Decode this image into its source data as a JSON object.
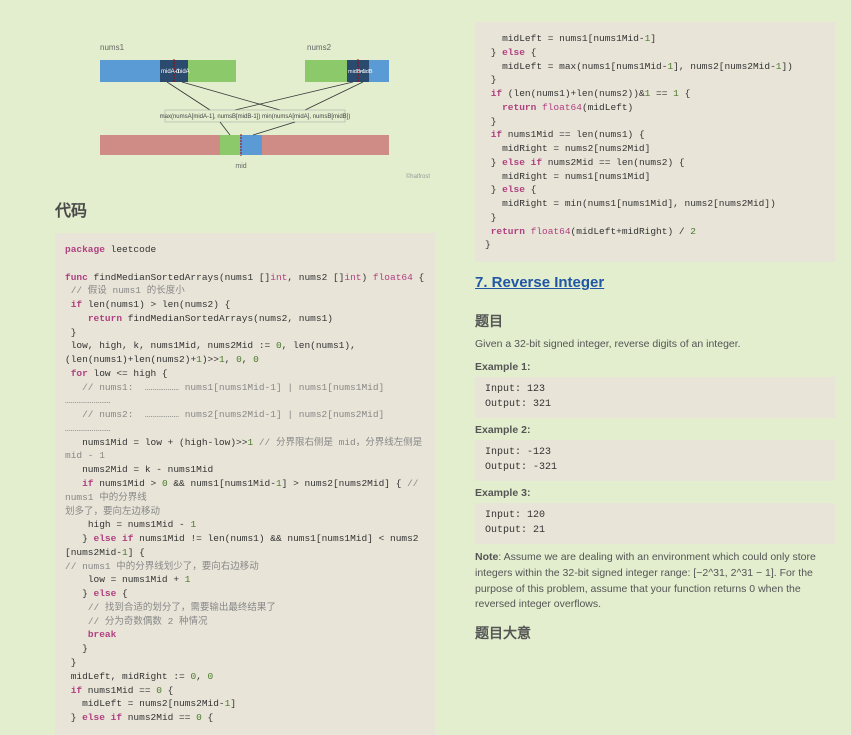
{
  "diagram": {
    "label_nums1": "nums1",
    "label_nums2": "nums2",
    "mid_label_a": "midA-1",
    "mid_label_a2": "midA",
    "mid_label_b": "midB-1",
    "mid_label_b2": "midB",
    "formula": "max(numsA[midA-1], numsB[midB-1])    min(numsA[midA], numsB[midB])",
    "mid_bottom": "mid",
    "watermark": "©halfrost"
  },
  "left": {
    "heading": "代码",
    "code_lines": [
      {
        "t": "<span class='kw'>package</span> leetcode"
      },
      {
        "t": ""
      },
      {
        "t": "<span class='kw'>func</span> <span class='fn'>findMedianSortedArrays</span>(nums1 []<span class='ty'>int</span>, nums2 []<span class='ty'>int</span>) <span class='ty'>float64</span> {"
      },
      {
        "t": " <span class='cm'>// 假设 nums1 的长度小</span>"
      },
      {
        "t": " <span class='kw'>if</span> <span class='fn'>len</span>(nums1) > <span class='fn'>len</span>(nums2) {"
      },
      {
        "t": "    <span class='kw'>return</span> findMedianSortedArrays(nums2, nums1)"
      },
      {
        "t": " }"
      },
      {
        "t": " low, high, k, nums1Mid, nums2Mid := <span class='nm'>0</span>, <span class='fn'>len</span>(nums1), "
      },
      {
        "t": "(<span class='fn'>len</span>(nums1)+<span class='fn'>len</span>(nums2)+<span class='nm'>1</span>)>><span class='nm'>1</span>, <span class='nm'>0</span>, <span class='nm'>0</span>"
      },
      {
        "t": " <span class='kw'>for</span> low <= high {"
      },
      {
        "t": "   <span class='cm'>// nums1:  ……………… nums1[nums1Mid-1] | nums1[nums1Mid] ……………………</span>"
      },
      {
        "t": "   <span class='cm'>// nums2:  ……………… nums2[nums2Mid-1] | nums2[nums2Mid] ……………………</span>"
      },
      {
        "t": "   nums1Mid = low + (high-low)>><span class='nm'>1</span> <span class='cm'>// 分界限右侧是 mid，分界线左侧是 mid - 1</span>"
      },
      {
        "t": "   nums2Mid = k - nums1Mid"
      },
      {
        "t": "   <span class='kw'>if</span> nums1Mid > <span class='nm'>0</span> && nums1[nums1Mid-<span class='nm'>1</span>] > nums2[nums2Mid] { <span class='cm'>// nums1 中的分界线</span>"
      },
      {
        "t": "<span class='cm'>划多了，要向左边移动</span>"
      },
      {
        "t": "    high = nums1Mid - <span class='nm'>1</span>"
      },
      {
        "t": "   } <span class='kw'>else if</span> nums1Mid != <span class='fn'>len</span>(nums1) && nums1[nums1Mid] < nums2[nums2Mid-<span class='nm'>1</span>] { "
      },
      {
        "t": "<span class='cm'>// nums1 中的分界线划少了，要向右边移动</span>"
      },
      {
        "t": "    low = nums1Mid + <span class='nm'>1</span>"
      },
      {
        "t": "   } <span class='kw'>else</span> {"
      },
      {
        "t": "    <span class='cm'>// 找到合适的划分了，需要输出最终结果了</span>"
      },
      {
        "t": "    <span class='cm'>// 分为奇数偶数 2 种情况</span>"
      },
      {
        "t": "    <span class='kw'>break</span>"
      },
      {
        "t": "   }"
      },
      {
        "t": " }"
      },
      {
        "t": " midLeft, midRight := <span class='nm'>0</span>, <span class='nm'>0</span>"
      },
      {
        "t": " <span class='kw'>if</span> nums1Mid == <span class='nm'>0</span> {"
      },
      {
        "t": "   midLeft = nums2[nums2Mid-<span class='nm'>1</span>]"
      },
      {
        "t": " } <span class='kw'>else if</span> nums2Mid == <span class='nm'>0</span> {"
      }
    ]
  },
  "right": {
    "code_lines": [
      {
        "t": "   midLeft = nums1[nums1Mid-<span class='nm'>1</span>]"
      },
      {
        "t": " } <span class='kw'>else</span> {"
      },
      {
        "t": "   midLeft = <span class='fn'>max</span>(nums1[nums1Mid-<span class='nm'>1</span>], nums2[nums2Mid-<span class='nm'>1</span>])"
      },
      {
        "t": " }"
      },
      {
        "t": " <span class='kw'>if</span> (<span class='fn'>len</span>(nums1)+<span class='fn'>len</span>(nums2))&<span class='nm'>1</span> == <span class='nm'>1</span> {"
      },
      {
        "t": "   <span class='kw'>return</span> <span class='ty'>float64</span>(midLeft)"
      },
      {
        "t": " }"
      },
      {
        "t": " <span class='kw'>if</span> nums1Mid == <span class='fn'>len</span>(nums1) {"
      },
      {
        "t": "   midRight = nums2[nums2Mid]"
      },
      {
        "t": " } <span class='kw'>else if</span> nums2Mid == <span class='fn'>len</span>(nums2) {"
      },
      {
        "t": "   midRight = nums1[nums1Mid]"
      },
      {
        "t": " } <span class='kw'>else</span> {"
      },
      {
        "t": "   midRight = <span class='fn'>min</span>(nums1[nums1Mid], nums2[nums2Mid])"
      },
      {
        "t": " }"
      },
      {
        "t": " <span class='kw'>return</span> <span class='ty'>float64</span>(midLeft+midRight) / <span class='nm'>2</span>"
      },
      {
        "t": "}"
      }
    ],
    "link_heading": "7. Reverse Integer",
    "sub_heading_1": "题目",
    "desc": "Given a 32-bit signed integer, reverse digits of an integer.",
    "example1_label": "Example 1:",
    "example1_io": "Input: 123\nOutput: 321",
    "example2_label": "Example 2:",
    "example2_io": "Input: -123\nOutput: -321",
    "example3_label": "Example 3:",
    "example3_io": "Input: 120\nOutput: 21",
    "note_label": "Note",
    "note_text": ": Assume we are dealing with an environment which could only store integers within the 32-bit signed integer range: [−2^31,  2^31 − 1]. For the purpose of this problem, assume that your function returns 0 when the reversed integer overflows.",
    "sub_heading_2": "题目大意"
  }
}
